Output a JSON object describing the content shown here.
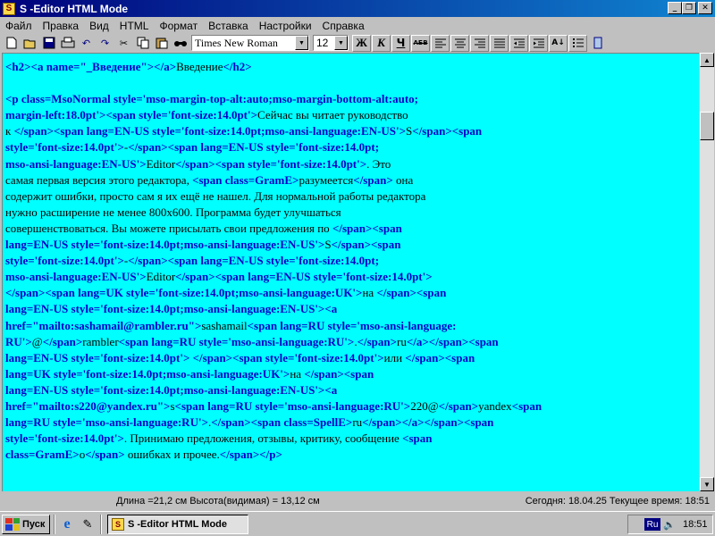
{
  "window": {
    "title": "S -Editor HTML Mode",
    "title_icon": "S"
  },
  "menu": [
    "Файл",
    "Правка",
    "Вид",
    "HTML",
    "Формат",
    "Вставка",
    "Настройки",
    "Справка"
  ],
  "toolbar": {
    "font_name": "Times New Roman",
    "font_size": "12",
    "bold_label": "Ж",
    "italic_label": "К",
    "underline_label": "Ч",
    "strike_label": "АБВ"
  },
  "editor": {
    "lines": [
      [
        [
          "tag",
          "<h2><a name=\"_Введение\"></a>"
        ],
        [
          "txt",
          "Введение"
        ],
        [
          "tag",
          "</h2>"
        ]
      ],
      [],
      [
        [
          "tag",
          "<p class=MsoNormal style='mso-margin-top-alt:auto;mso-margin-bottom-alt:auto;"
        ]
      ],
      [
        [
          "tag",
          "margin-left:18.0pt'><span style='font-size:14.0pt'>"
        ],
        [
          "txt",
          "Сейчас вы читает руководство"
        ]
      ],
      [
        [
          "txt",
          "к "
        ],
        [
          "tag",
          "</span><span lang=EN-US style='font-size:14.0pt;mso-ansi-language:EN-US'>"
        ],
        [
          "txt",
          "S"
        ],
        [
          "tag",
          "</span><span"
        ]
      ],
      [
        [
          "tag",
          "style='font-size:14.0pt'>"
        ],
        [
          "txt",
          "-"
        ],
        [
          "tag",
          "</span><span lang=EN-US style='font-size:14.0pt;"
        ]
      ],
      [
        [
          "tag",
          "mso-ansi-language:EN-US'>"
        ],
        [
          "txt",
          "Editor"
        ],
        [
          "tag",
          "</span><span style='font-size:14.0pt'>"
        ],
        [
          "txt",
          ". Это"
        ]
      ],
      [
        [
          "txt",
          "самая первая версия этого редактора, "
        ],
        [
          "tag",
          "<span class=GramE>"
        ],
        [
          "txt",
          "разумеется"
        ],
        [
          "tag",
          "</span>"
        ],
        [
          "txt",
          " она"
        ]
      ],
      [
        [
          "txt",
          "содержит ошибки, просто сам я их ещё не нашел. Для нормальной работы редактора"
        ]
      ],
      [
        [
          "txt",
          "нужно расширение не менее 800х600. Программа будет улучшаться"
        ]
      ],
      [
        [
          "txt",
          "совершенствоваться. Вы можете присылать свои предложения по "
        ],
        [
          "tag",
          "</span><span"
        ]
      ],
      [
        [
          "tag",
          "lang=EN-US style='font-size:14.0pt;mso-ansi-language:EN-US'>"
        ],
        [
          "txt",
          "S"
        ],
        [
          "tag",
          "</span><span"
        ]
      ],
      [
        [
          "tag",
          "style='font-size:14.0pt'>"
        ],
        [
          "txt",
          "-"
        ],
        [
          "tag",
          "</span><span lang=EN-US style='font-size:14.0pt;"
        ]
      ],
      [
        [
          "tag",
          "mso-ansi-language:EN-US'>"
        ],
        [
          "txt",
          "Editor"
        ],
        [
          "tag",
          "</span><span lang=EN-US style='font-size:14.0pt'>"
        ]
      ],
      [
        [
          "tag",
          "</span><span lang=UK style='font-size:14.0pt;mso-ansi-language:UK'>"
        ],
        [
          "txt",
          "на "
        ],
        [
          "tag",
          "</span><span"
        ]
      ],
      [
        [
          "tag",
          "lang=EN-US style='font-size:14.0pt;mso-ansi-language:EN-US'><a"
        ]
      ],
      [
        [
          "tag",
          "href=\"mailto:sashamail@rambler.ru\">"
        ],
        [
          "txt",
          "sashamail"
        ],
        [
          "tag",
          "<span lang=RU style='mso-ansi-language:"
        ]
      ],
      [
        [
          "tag",
          "RU'>"
        ],
        [
          "txt",
          "@"
        ],
        [
          "tag",
          "</span>"
        ],
        [
          "txt",
          "rambler"
        ],
        [
          "tag",
          "<span lang=RU style='mso-ansi-language:RU'>"
        ],
        [
          "txt",
          "."
        ],
        [
          "tag",
          "</span>"
        ],
        [
          "txt",
          "ru"
        ],
        [
          "tag",
          "</a></span><span"
        ]
      ],
      [
        [
          "tag",
          "lang=EN-US style='font-size:14.0pt'>"
        ],
        [
          "txt",
          " "
        ],
        [
          "tag",
          "</span><span style='font-size:14.0pt'>"
        ],
        [
          "txt",
          "или "
        ],
        [
          "tag",
          "</span><span"
        ]
      ],
      [
        [
          "tag",
          "lang=UK style='font-size:14.0pt;mso-ansi-language:UK'>"
        ],
        [
          "txt",
          "на "
        ],
        [
          "tag",
          "</span><span"
        ]
      ],
      [
        [
          "tag",
          "lang=EN-US style='font-size:14.0pt;mso-ansi-language:EN-US'><a"
        ]
      ],
      [
        [
          "tag",
          "href=\"mailto:s220@yandex.ru\">"
        ],
        [
          "txt",
          "s"
        ],
        [
          "tag",
          "<span lang=RU style='mso-ansi-language:RU'>"
        ],
        [
          "txt",
          "220@"
        ],
        [
          "tag",
          "</span>"
        ],
        [
          "txt",
          "yandex"
        ],
        [
          "tag",
          "<span"
        ]
      ],
      [
        [
          "tag",
          "lang=RU style='mso-ansi-language:RU'>"
        ],
        [
          "txt",
          "."
        ],
        [
          "tag",
          "</span><span class=SpellE>"
        ],
        [
          "txt",
          "ru"
        ],
        [
          "tag",
          "</span></a></span><span"
        ]
      ],
      [
        [
          "tag",
          "style='font-size:14.0pt'>"
        ],
        [
          "txt",
          ". Принимаю предложения, отзывы, критику, сообщение "
        ],
        [
          "tag",
          "<span"
        ]
      ],
      [
        [
          "tag",
          "class=GramE>"
        ],
        [
          "txt",
          "о"
        ],
        [
          "tag",
          "</span>"
        ],
        [
          "txt",
          " ошибках и прочее."
        ],
        [
          "tag",
          "</span></p>"
        ]
      ]
    ],
    "colors": {
      "background": "#00ffff",
      "tag": "#0000c8",
      "text": "#000000"
    }
  },
  "status": {
    "left": "Длина =21,2 см  Высота(видимая) = 13,12 см",
    "right": "Сегодня:  18.04.25  Текущее время:  18:51"
  },
  "taskbar": {
    "start_label": "Пуск",
    "task_label": "S -Editor HTML Mode",
    "lang": "Ru",
    "clock": "18:51"
  }
}
